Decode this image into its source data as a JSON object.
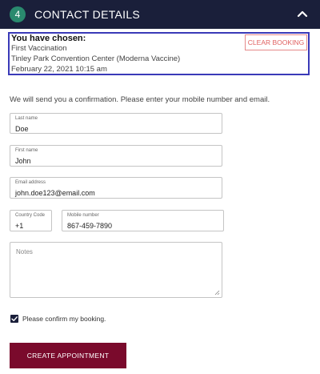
{
  "header": {
    "step_number": "4",
    "title": "CONTACT DETAILS",
    "collapse_icon": "chevron-up-icon"
  },
  "chosen": {
    "title": "You have chosen:",
    "dose": "First Vaccination",
    "location": "Tinley Park Convention Center (Moderna Vaccine)",
    "datetime": "February 22, 2021 10:15 am",
    "clear_label": "CLEAR BOOKING"
  },
  "info_text": "We will send you a confirmation. Please enter your mobile number and email.",
  "form": {
    "last_name": {
      "label": "Last name",
      "value": "Doe"
    },
    "first_name": {
      "label": "First name",
      "value": "John"
    },
    "email": {
      "label": "Email address",
      "value": "john.doe123@email.com"
    },
    "country_code": {
      "label": "Country Code",
      "value": "+1"
    },
    "mobile": {
      "label": "Mobile number",
      "value": "867-459-7890"
    },
    "notes": {
      "placeholder": "Notes",
      "value": ""
    }
  },
  "confirm": {
    "label": "Please confirm my booking.",
    "checked": true
  },
  "create_button_label": "CREATE APPOINTMENT",
  "colors": {
    "header_bg": "#1a1f3a",
    "step_badge": "#2a8a6e",
    "highlight_border": "#3a3ab8",
    "clear_button": "#e06060",
    "primary_button": "#7a0a2c"
  }
}
